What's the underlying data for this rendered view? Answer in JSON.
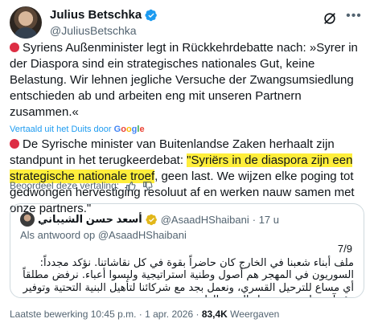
{
  "author": {
    "name": "Julius Betschka",
    "handle": "@JuliusBetschka"
  },
  "post": {
    "original_text": "Syriens Außenminister legt in Rückkehrdebatte nach: »Syrer in der Diaspora sind ein strategisches nationales Gut, keine Belastung. Wir lehnen jegliche Versuche der Zwangsumsiedlung entschieden ab und arbeiten eng mit unseren Partnern zusammen.«",
    "translated_label": "Vertaald uit het Duits door",
    "translated_brand": "Google",
    "translation_before": "De Syrische minister van Buitenlandse Zaken herhaalt zijn standpunt in het terugkeerdebat: ",
    "translation_highlight": "\"Syriërs in de diaspora zijn een strategische nationale troef",
    "translation_after": ", geen last. We wijzen elke poging tot gedwongen hervestiging resoluut af en werken nauw samen met onze partners.\"",
    "rate_label": "Beoordeel deze vertaling:"
  },
  "quote": {
    "name": "أسعد حسن الشيباني",
    "handle": "@AsaadHShaibani",
    "time": "· 17 u",
    "reply_label": "Als antwoord op @AsaadHShaibani",
    "counter": "7/9",
    "text": "ملف أبناء شعبنا في الخارج كان حاضراً بقوة في كل نقاشاتنا. نؤكد مجدداً: السوريون في المهجر هم أصول وطنية استراتيجية وليسوا أعباء. نرفض مطلقاً أي مساع للترحيل القسري، ونعمل بجد مع شركائنا لتأهيل البنية التحتية وتوفير بيئة آمنة تليق بمن يختار العودة الطوعية"
  },
  "meta": {
    "time": "Laatste bewerking 10:45 p.m. · 1 apr. 2026 · ",
    "views_count": "83,4K",
    "views_label": " Weergaven"
  },
  "colors": {
    "accent": "#1d9bf0",
    "highlight": "#ffee3b",
    "red_dot": "#dd2e44",
    "gold_check": "#e2b719"
  }
}
